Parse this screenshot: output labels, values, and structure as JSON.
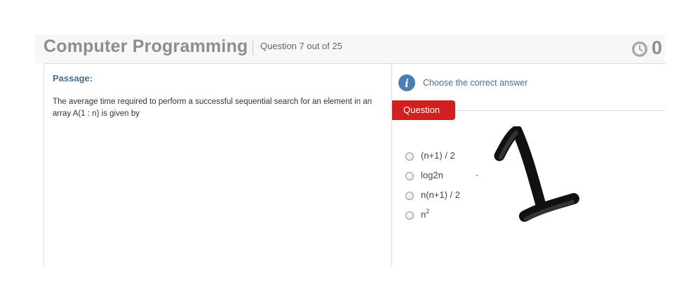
{
  "header": {
    "title": "Computer Programming",
    "question_counter": "Question 7 out of 25",
    "timer_value": "0"
  },
  "passage": {
    "label": "Passage:",
    "text": "The average time required to perform a successful sequential search for an element in an array A(1 : n) is given by"
  },
  "question_panel": {
    "instruction": "Choose the correct answer",
    "tab_label": "Question",
    "options": [
      {
        "label": "(n+1) / 2"
      },
      {
        "label": "log2n"
      },
      {
        "label": "n(n+1) / 2"
      },
      {
        "base": "n",
        "exponent": "2"
      }
    ]
  },
  "colors": {
    "accent_red": "#d21f1f",
    "info_blue": "#4a7fb5",
    "title_gray": "#8d8d8d",
    "label_blue": "#4a6e8c"
  },
  "icons": {
    "timer": "clock-icon",
    "info": "info-icon",
    "annotation": "handwritten-one-mark"
  }
}
